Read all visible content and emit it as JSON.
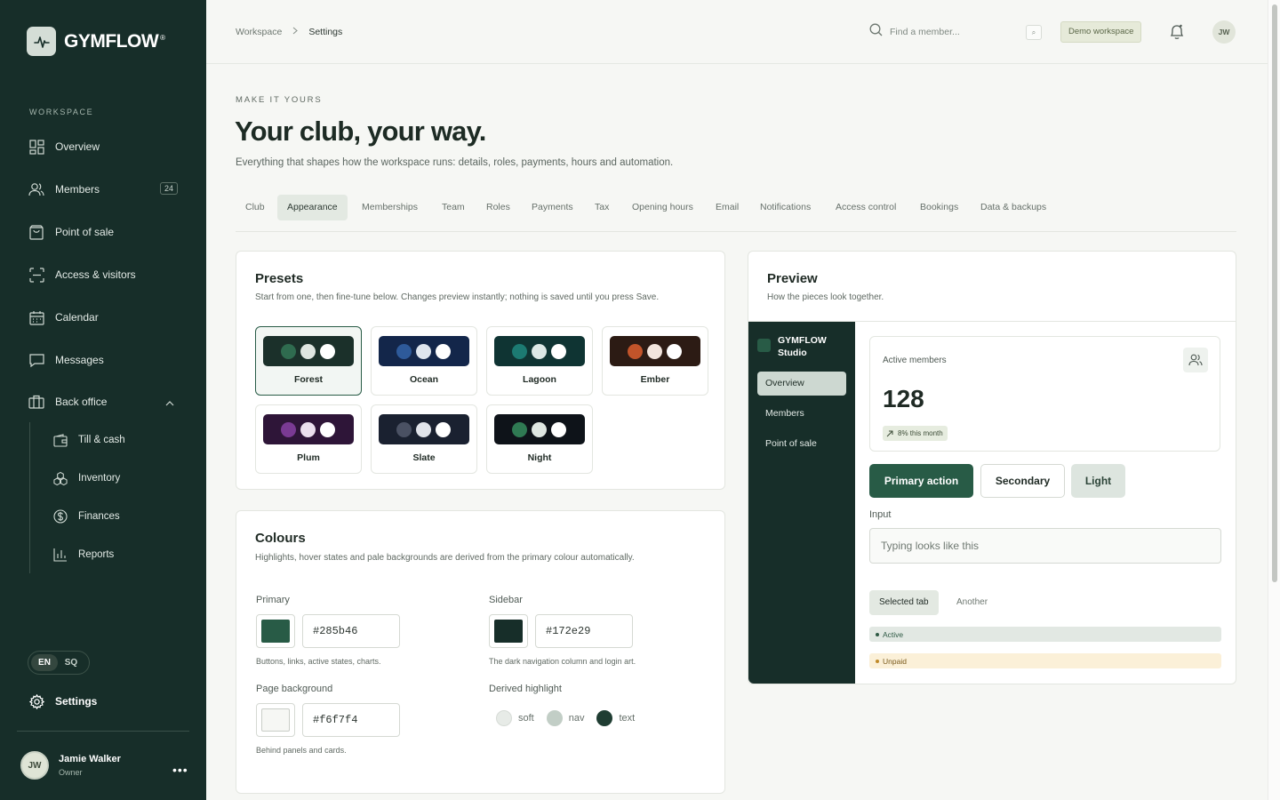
{
  "brand": {
    "name": "GYMFLOW",
    "reg": "®"
  },
  "sidebar": {
    "section": "WORKSPACE",
    "items": [
      {
        "label": "Overview",
        "icon": "dashboard-icon"
      },
      {
        "label": "Members",
        "icon": "users-icon",
        "badge": "24"
      },
      {
        "label": "Point of sale",
        "icon": "shopping-bag-icon"
      },
      {
        "label": "Access & visitors",
        "icon": "scan-icon"
      },
      {
        "label": "Calendar",
        "icon": "calendar-icon"
      },
      {
        "label": "Messages",
        "icon": "message-icon"
      },
      {
        "label": "Back office",
        "icon": "briefcase-icon"
      }
    ],
    "sub_items": [
      {
        "label": "Till & cash",
        "icon": "wallet-icon"
      },
      {
        "label": "Inventory",
        "icon": "boxes-icon"
      },
      {
        "label": "Finances",
        "icon": "dollar-icon"
      },
      {
        "label": "Reports",
        "icon": "bar-chart-icon"
      }
    ],
    "languages": [
      "EN",
      "SQ"
    ],
    "settings": "Settings",
    "user": {
      "initials": "JW",
      "name": "Jamie Walker",
      "role": "Owner"
    }
  },
  "topbar": {
    "breadcrumb": [
      "Workspace",
      "Settings"
    ],
    "search_placeholder": "Find a member...",
    "kbd": "⌕",
    "demo_badge": "Demo workspace",
    "avatar": "JW"
  },
  "page": {
    "eyebrow": "MAKE IT YOURS",
    "title": "Your club, your way.",
    "lead": "Everything that shapes how the workspace runs: details, roles, payments, hours and automation."
  },
  "tabs": [
    "Club",
    "Appearance",
    "Memberships",
    "Team",
    "Roles",
    "Payments",
    "Tax",
    "Opening hours",
    "Email",
    "Notifications",
    "Access control",
    "Bookings",
    "Data & backups"
  ],
  "active_tab": "Appearance",
  "presets": {
    "title": "Presets",
    "subtitle": "Start from one, then fine-tune below. Changes preview instantly; nothing is saved until you press Save.",
    "items": [
      {
        "name": "Forest",
        "bg": "#1b302a",
        "accent": "#2f6b4f",
        "selected": true
      },
      {
        "name": "Ocean",
        "bg": "#13264a",
        "accent": "#2e5a9a"
      },
      {
        "name": "Lagoon",
        "bg": "#0f3433",
        "accent": "#1c7a72"
      },
      {
        "name": "Ember",
        "bg": "#2c1b14",
        "accent": "#c2542a"
      },
      {
        "name": "Plum",
        "bg": "#2e1538",
        "accent": "#7a3a93"
      },
      {
        "name": "Slate",
        "bg": "#1a2130",
        "accent": "#4a5163"
      },
      {
        "name": "Night",
        "bg": "#0e1319",
        "accent": "#2f7a53"
      }
    ]
  },
  "colours": {
    "title": "Colours",
    "subtitle": "Highlights, hover states and pale backgrounds are derived from the primary colour automatically.",
    "primary": {
      "label": "Primary",
      "value": "#285b46",
      "help": "Buttons, links, active states, charts."
    },
    "sidebar": {
      "label": "Sidebar",
      "value": "#172e29",
      "help": "The dark navigation column and login art."
    },
    "page_bg": {
      "label": "Page background",
      "value": "#f6f7f4",
      "help": "Behind panels and cards."
    },
    "derived": {
      "label": "Derived highlight",
      "items": [
        {
          "name": "soft",
          "color": "#e7ebe7"
        },
        {
          "name": "nav",
          "color": "#c2cec6"
        },
        {
          "name": "text",
          "color": "#1f3d32"
        }
      ]
    }
  },
  "preview": {
    "title": "Preview",
    "subtitle": "How the pieces look together.",
    "brand": "GYMFLOW Studio",
    "nav": [
      "Overview",
      "Members",
      "Point of sale"
    ],
    "stat": {
      "label": "Active members",
      "value": "128",
      "trend": "8% this month"
    },
    "buttons": {
      "primary": "Primary action",
      "secondary": "Secondary",
      "light": "Light"
    },
    "input": {
      "label": "Input",
      "placeholder": "Typing looks like this"
    },
    "tabs": [
      "Selected tab",
      "Another"
    ],
    "pills": [
      {
        "label": "Active",
        "bg": "#e2e8e3",
        "color": "#2f5a45"
      },
      {
        "label": "Unpaid",
        "bg": "#fbf0d8",
        "color": "#7a5a1c"
      }
    ]
  }
}
